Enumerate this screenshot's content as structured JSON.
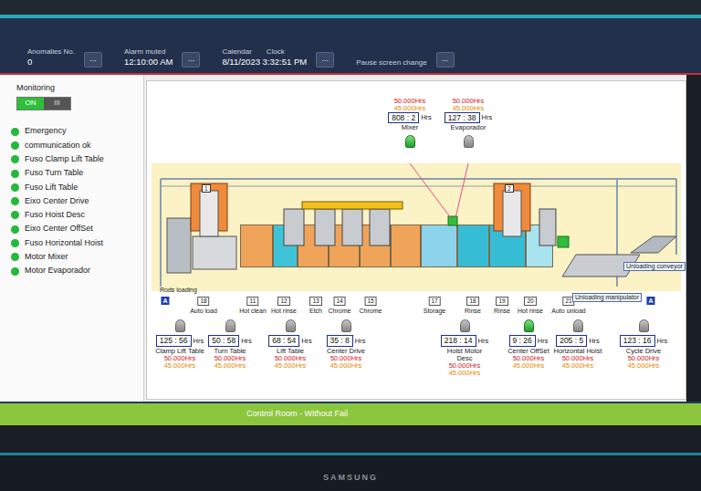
{
  "header": {
    "fields": [
      {
        "labels": [
          "Anomalies No."
        ],
        "value": "0",
        "button": "..."
      },
      {
        "labels": [
          "Alarm muted"
        ],
        "value": "12:10:00 AM",
        "button": "..."
      },
      {
        "labels": [
          "Calendar",
          "Clock"
        ],
        "value": "8/11/2023 3:32:51 PM",
        "button": "..."
      },
      {
        "labels": [
          "Pause screen change"
        ],
        "button": "..."
      }
    ]
  },
  "monitoring": {
    "title": "Monitoring",
    "on_label": "ON",
    "off_label": "III",
    "on": true
  },
  "status_list": [
    {
      "label": "Emergency",
      "ok": true
    },
    {
      "label": "communication ok",
      "ok": true
    },
    {
      "label": "Fuso Clamp Lift Table",
      "ok": true
    },
    {
      "label": "Fuso Turn Table",
      "ok": true
    },
    {
      "label": "Fuso Lift Table",
      "ok": true
    },
    {
      "label": "Eixo Center Drive",
      "ok": true
    },
    {
      "label": "Fuso Hoist Desc",
      "ok": true
    },
    {
      "label": "Eixo Center OffSet",
      "ok": true
    },
    {
      "label": "Fuso Horizontal Hoist",
      "ok": true
    },
    {
      "label": "Motor Mixer",
      "ok": true
    },
    {
      "label": "Motor Evaporador",
      "ok": true
    }
  ],
  "diagram": {
    "top_counters": [
      {
        "name": "Mixer",
        "value": "808 : 2",
        "unit": "Hrs",
        "limit_high": "50.000Hrs",
        "limit_low": "45.000Hrs",
        "on": true
      },
      {
        "name": "Evaporador",
        "value": "127 : 38",
        "unit": "Hrs",
        "limit_high": "50.000Hrs",
        "limit_low": "45.000Hrs",
        "on": false
      }
    ],
    "bottom_counters": [
      {
        "name": "Clamp Lift Table",
        "value": "125 : 56",
        "unit": "Hrs",
        "limit_high": "50.000Hrs",
        "limit_low": "45.000Hrs",
        "on": false
      },
      {
        "name": "Turn Table",
        "value": "50 : 58",
        "unit": "Hrs",
        "limit_high": "50.000Hrs",
        "limit_low": "45.000Hrs",
        "on": false
      },
      {
        "name": "Lift Table",
        "value": "68 : 54",
        "unit": "Hrs",
        "limit_high": "50.000Hrs",
        "limit_low": "45.000Hrs",
        "on": false
      },
      {
        "name": "Center Drive",
        "value": "35 : 8",
        "unit": "Hrs",
        "limit_high": "50.000Hrs",
        "limit_low": "45.000Hrs",
        "on": false
      },
      {
        "name": "Hoist Motor Desc",
        "value": "218 : 14",
        "unit": "Hrs",
        "limit_high": "50.000Hrs",
        "limit_low": "45.000Hrs",
        "on": false
      },
      {
        "name": "Center OffSet",
        "value": "9 : 26",
        "unit": "Hrs",
        "limit_high": "50.000Hrs",
        "limit_low": "45.000Hrs",
        "on": true
      },
      {
        "name": "Horizontal Hoist",
        "value": "205 : 5",
        "unit": "Hrs",
        "limit_high": "50.000Hrs",
        "limit_low": "45.000Hrs",
        "on": false
      },
      {
        "name": "Cycle Drive",
        "value": "123 : 16",
        "unit": "Hrs",
        "limit_high": "50.000Hrs",
        "limit_low": "45.000Hrs",
        "on": false
      }
    ],
    "stations": [
      {
        "kind": "badge",
        "label": "A"
      },
      {
        "kind": "station",
        "number": "18",
        "label": "Auto load"
      },
      {
        "kind": "station",
        "number": "11",
        "label": "Hot clean"
      },
      {
        "kind": "station",
        "number": "12",
        "label": "Hot rinse"
      },
      {
        "kind": "station",
        "number": "13",
        "label": "Etch"
      },
      {
        "kind": "station",
        "number": "14",
        "label": "Chrome"
      },
      {
        "kind": "station",
        "number": "15",
        "label": "Chrome"
      },
      {
        "kind": "station",
        "number": "17",
        "label": "Storage"
      },
      {
        "kind": "station",
        "number": "18",
        "label": "Rinse"
      },
      {
        "kind": "station",
        "number": "19",
        "label": "Rinse"
      },
      {
        "kind": "station",
        "number": "20",
        "label": "Hot rinse"
      },
      {
        "kind": "station",
        "number": "21",
        "label": "Auto unload"
      },
      {
        "kind": "badge",
        "label": "A"
      }
    ],
    "tags": [
      {
        "text": "Rods loading",
        "kind": "plain"
      },
      {
        "text": "Unloading conveyor",
        "kind": "boxed"
      },
      {
        "text": "Unloading manipulator",
        "kind": "boxed"
      }
    ],
    "hoists": [
      {
        "label": "1"
      },
      {
        "label": "2"
      }
    ],
    "tanks": [
      {
        "color": "#f0a45a"
      },
      {
        "color": "#3fc3d8"
      },
      {
        "color": "#f0a45a"
      },
      {
        "color": "#f0a45a"
      },
      {
        "color": "#f0a45a"
      },
      {
        "color": "#f0a45a"
      },
      {
        "color": "#8ed3ec"
      },
      {
        "color": "#37bcd6"
      },
      {
        "color": "#37bcd6"
      },
      {
        "color": "#a8e3ef"
      }
    ]
  },
  "footer": {
    "text": "Control Room - Without Fail"
  },
  "brand": {
    "text": "SAMSUNG"
  }
}
